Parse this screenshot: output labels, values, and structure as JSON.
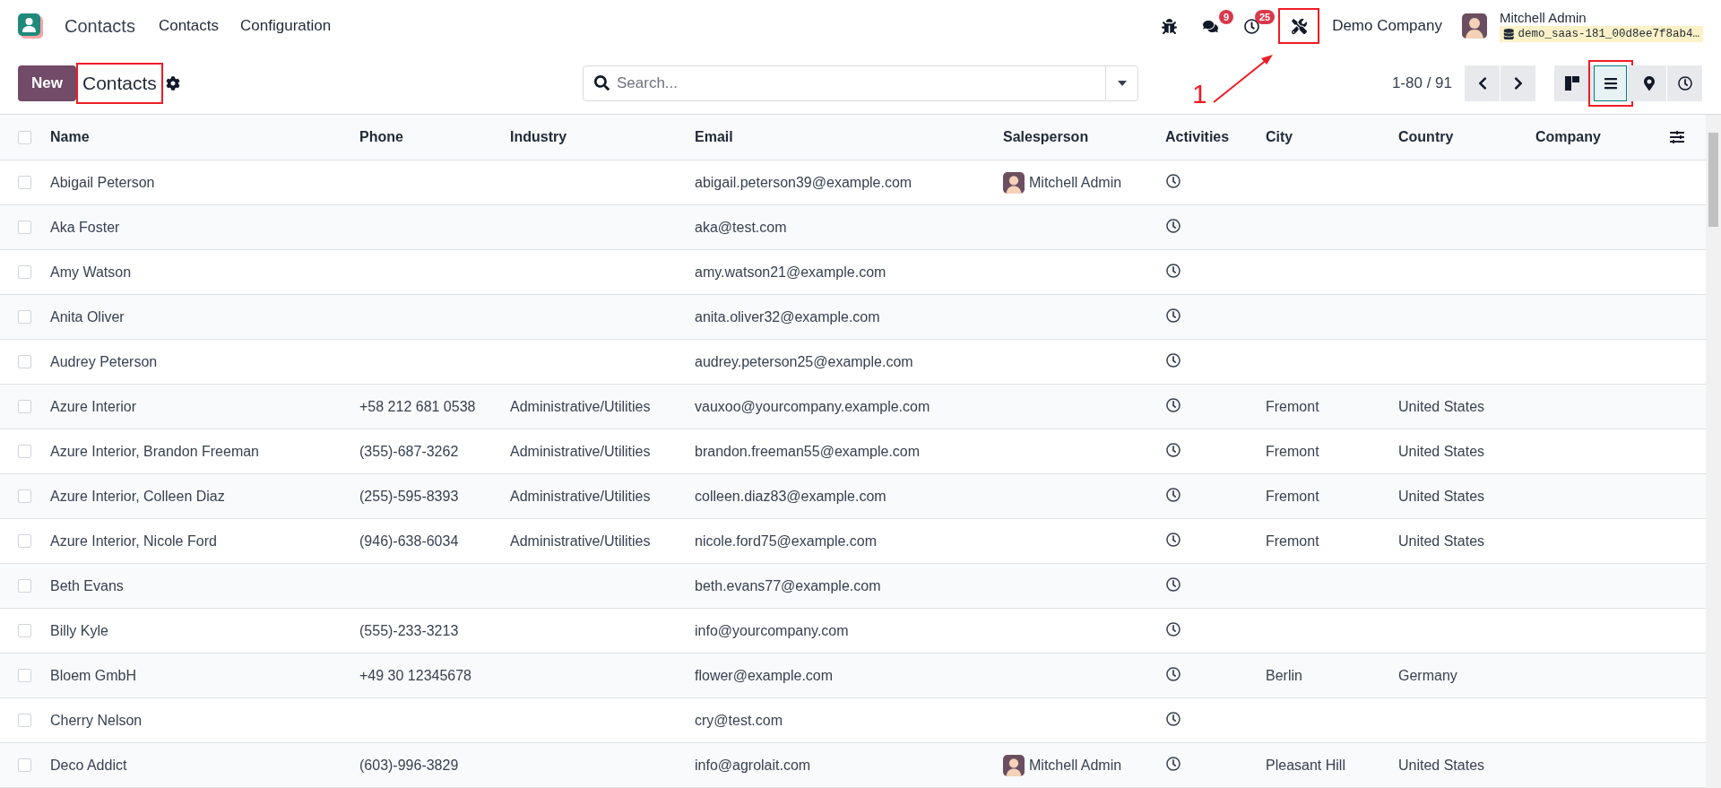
{
  "app": {
    "name": "Contacts",
    "menu": [
      {
        "label": "Contacts"
      },
      {
        "label": "Configuration"
      }
    ]
  },
  "systray": {
    "items": [
      {
        "kind": "debug",
        "highlighted": false
      },
      {
        "kind": "messages",
        "badge": "9",
        "highlighted": false
      },
      {
        "kind": "activities",
        "badge": "25",
        "highlighted": false
      },
      {
        "kind": "tools",
        "highlighted": true
      }
    ],
    "company": "Demo Company",
    "user": {
      "name": "Mitchell Admin",
      "database": "demo_saas-181_00d8ee7f8ab4…"
    }
  },
  "control_panel": {
    "new_button": "New",
    "breadcrumb": {
      "label": "Contacts",
      "highlighted": true
    },
    "search": {
      "placeholder": "Search..."
    },
    "pager": "1-80 / 91",
    "views": [
      {
        "kind": "kanban",
        "selected": false,
        "highlighted": false
      },
      {
        "kind": "list",
        "selected": true,
        "highlighted": true
      },
      {
        "kind": "map",
        "selected": false,
        "highlighted": false
      },
      {
        "kind": "activity",
        "selected": false,
        "highlighted": false
      }
    ]
  },
  "callout": {
    "label": "1"
  },
  "table": {
    "all_checked": false,
    "columns": [
      "Name",
      "Phone",
      "Industry",
      "Email",
      "Salesperson",
      "Activities",
      "City",
      "Country",
      "Company"
    ],
    "rows": [
      {
        "checked": false,
        "name": "Abigail Peterson",
        "email": "abigail.peterson39@example.com",
        "salesperson": "Mitchell Admin"
      },
      {
        "checked": false,
        "name": "Aka Foster",
        "email": "aka@test.com"
      },
      {
        "checked": false,
        "name": "Amy Watson",
        "email": "amy.watson21@example.com"
      },
      {
        "checked": false,
        "name": "Anita Oliver",
        "email": "anita.oliver32@example.com"
      },
      {
        "checked": false,
        "name": "Audrey Peterson",
        "email": "audrey.peterson25@example.com"
      },
      {
        "checked": false,
        "name": "Azure Interior",
        "phone": "+58 212 681 0538",
        "industry": "Administrative/Utilities",
        "email": "vauxoo@yourcompany.example.com",
        "city": "Fremont",
        "country": "United States"
      },
      {
        "checked": false,
        "name": "Azure Interior, Brandon Freeman",
        "phone": "(355)-687-3262",
        "industry": "Administrative/Utilities",
        "email": "brandon.freeman55@example.com",
        "city": "Fremont",
        "country": "United States"
      },
      {
        "checked": false,
        "name": "Azure Interior, Colleen Diaz",
        "phone": "(255)-595-8393",
        "industry": "Administrative/Utilities",
        "email": "colleen.diaz83@example.com",
        "city": "Fremont",
        "country": "United States"
      },
      {
        "checked": false,
        "name": "Azure Interior, Nicole Ford",
        "phone": "(946)-638-6034",
        "industry": "Administrative/Utilities",
        "email": "nicole.ford75@example.com",
        "city": "Fremont",
        "country": "United States"
      },
      {
        "checked": false,
        "name": "Beth Evans",
        "email": "beth.evans77@example.com"
      },
      {
        "checked": false,
        "name": "Billy Kyle",
        "phone": "(555)-233-3213",
        "email": "info@yourcompany.com"
      },
      {
        "checked": false,
        "name": "Bloem GmbH",
        "phone": "+49 30 12345678",
        "email": "flower@example.com",
        "city": "Berlin",
        "country": "Germany"
      },
      {
        "checked": false,
        "name": "Cherry Nelson",
        "email": "cry@test.com"
      },
      {
        "checked": false,
        "name": "Deco Addict",
        "phone": "(603)-996-3829",
        "email": "info@agrolait.com",
        "salesperson": "Mitchell Admin",
        "city": "Pleasant Hill",
        "country": "United States"
      }
    ]
  }
}
